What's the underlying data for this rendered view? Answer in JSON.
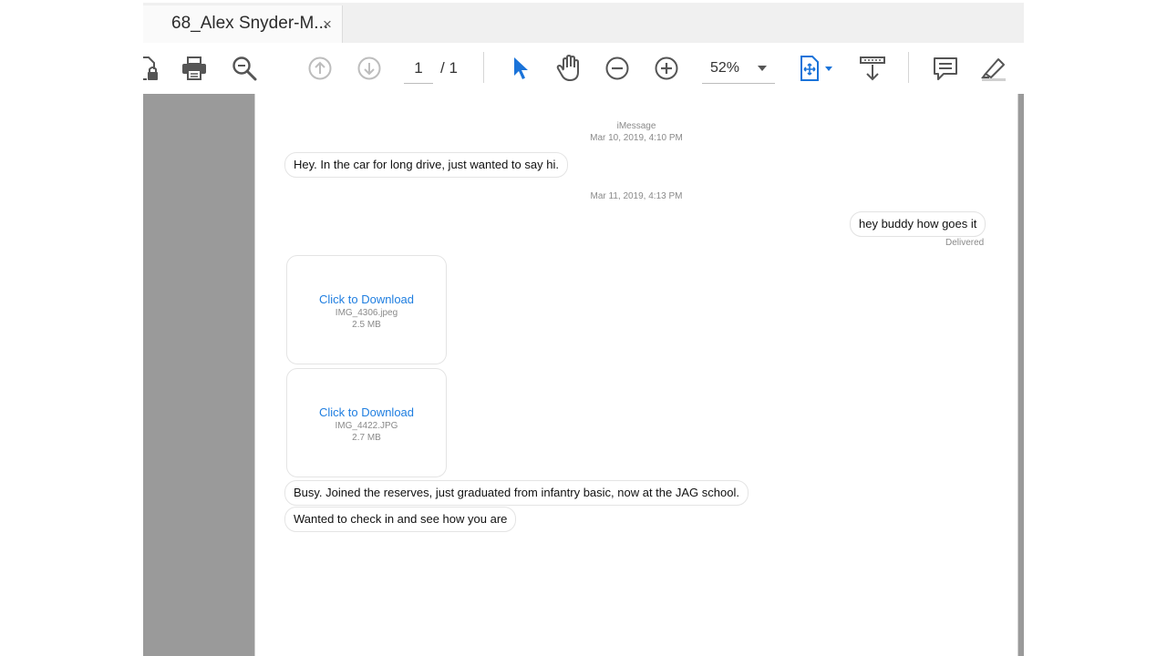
{
  "tab": {
    "title": "68_Alex Snyder-M...",
    "close": "×"
  },
  "toolbar": {
    "page_current": "1",
    "page_total": "/ 1",
    "zoom": "52%",
    "icons": [
      "lock-file-icon",
      "print-icon",
      "search-icon",
      "prev-page-icon",
      "next-page-icon",
      "select-cursor-icon",
      "hand-icon",
      "zoom-out-icon",
      "zoom-in-icon",
      "fit-page-icon",
      "scroll-mode-icon",
      "comment-icon",
      "highlight-icon"
    ]
  },
  "conversation": {
    "service": "iMessage",
    "ts1": "Mar 10, 2019, 4:10 PM",
    "msg1": "Hey. In the car for long drive, just wanted to say hi.",
    "ts2": "Mar 11, 2019, 4:13 PM",
    "msg2": "hey buddy how goes it",
    "status2": "Delivered",
    "attachments": [
      {
        "action": "Click to Download",
        "filename": "IMG_4306.jpeg",
        "size": "2.5 MB"
      },
      {
        "action": "Click to Download",
        "filename": "IMG_4422.JPG",
        "size": "2.7 MB"
      }
    ],
    "msg3": "Busy. Joined the reserves, just graduated from infantry basic, now at the JAG school.",
    "msg4": "Wanted to check in and see how you are"
  },
  "colors": {
    "accent": "#1f7ee0",
    "gutter": "#9a9a9a",
    "tabbar": "#f0f0f0"
  }
}
